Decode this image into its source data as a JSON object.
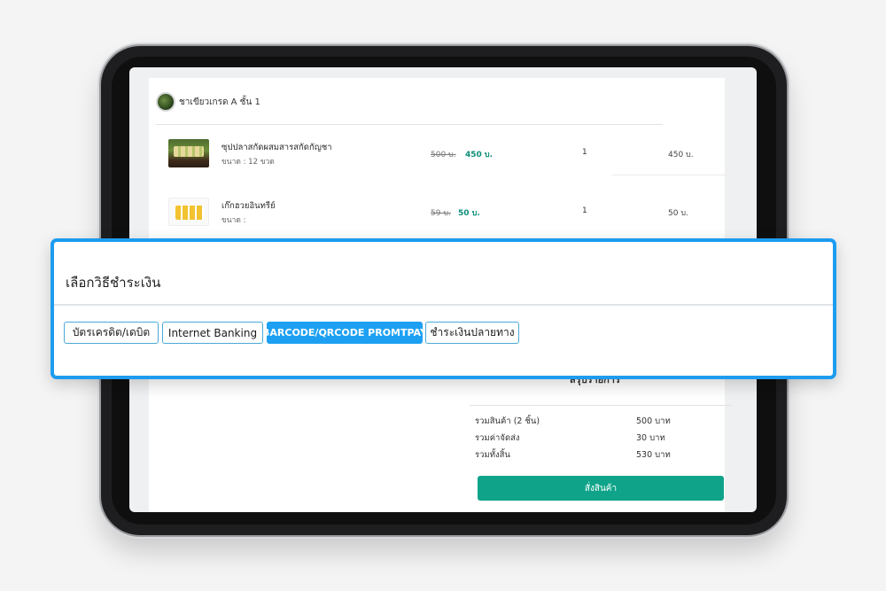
{
  "shop": {
    "name": "ชาเขียวเกรด A ชั้น 1"
  },
  "products": [
    {
      "name": "ซุปปลาสกัดผสมสารสกัดกัญชา",
      "size": "ขนาด : 12 ขวด",
      "old_price": "500 บ.",
      "price": "450 บ.",
      "qty": "1",
      "total": "450 บ."
    },
    {
      "name": "เก๊กฮวยอินทรีย์",
      "size": "ขนาด :",
      "old_price": "59 บ.",
      "price": "50 บ.",
      "qty": "1",
      "total": "50 บ."
    }
  ],
  "summary": {
    "title": "สรุปรายการ",
    "rows": [
      {
        "label": "รวมสินค้า (2 ชิ้น)",
        "value": "500 บาท"
      },
      {
        "label": "รวมค่าจัดส่ง",
        "value": "30 บาท"
      },
      {
        "label": "รวมทั้งสิ้น",
        "value": "530 บาท"
      }
    ],
    "order_button": "สั่งสินค้า"
  },
  "payment": {
    "title": "เลือกวิธีชำระเงิน",
    "options": [
      {
        "label": "บัตรเครดิต/เดบิต",
        "selected": false
      },
      {
        "label": "Internet Banking",
        "selected": false
      },
      {
        "label": "BARCODE/QRCODE PROMTPAY",
        "selected": true
      },
      {
        "label": "ชำระเงินปลายทาง",
        "selected": false
      }
    ],
    "accent_color": "#1ea0f2"
  },
  "colors": {
    "brand_green": "#0fa48a",
    "price_green": "#0d8f78"
  }
}
